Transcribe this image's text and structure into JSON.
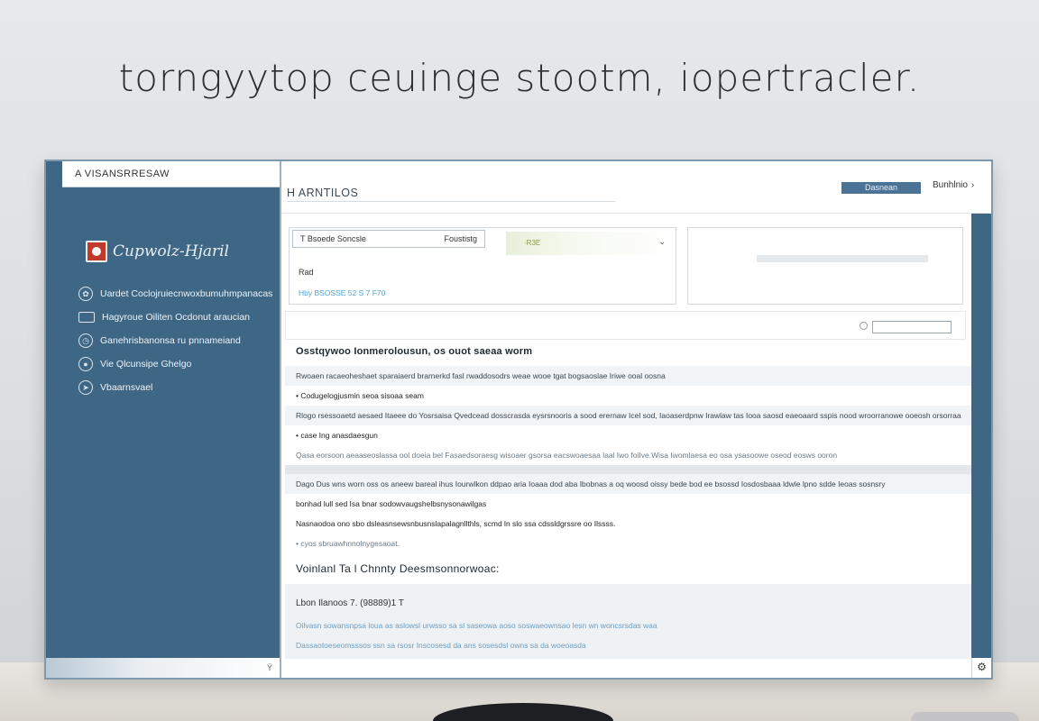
{
  "headline": "torngyytop ceuinge stootm, iopertracler.",
  "sidebar": {
    "top_label": "A VISANSRRESAW",
    "brand": "Cupwolz-Hjaril",
    "items": [
      {
        "label": "Uardet Coclojruiecnwoxbumuhmpanacas",
        "icon": "flower-icon"
      },
      {
        "label": "Hagyroue Oiliten Ocdonut araucian",
        "icon": "card-icon"
      },
      {
        "label": "Ganehrisbanonsa ru pnnameiand",
        "icon": "clock-icon"
      },
      {
        "label": "Vie Qlcunsipe Ghelgo",
        "icon": "user-icon"
      },
      {
        "label": "Vbaarnsvael",
        "icon": "arrow-icon"
      }
    ],
    "bottom_glyph": "Ÿ"
  },
  "header": {
    "title": "H ARNTILOS",
    "button_label": "Dasnean",
    "link_label": "Bunhlnio"
  },
  "form": {
    "select_value": "T Bsoede Soncsle",
    "select_placeholder": "Foustistg",
    "highlight_text": "·R3E",
    "label": "Rad",
    "link": "Hby BSOSSE 52 S 7 F70"
  },
  "search": {
    "placeholder": ""
  },
  "content": {
    "section_title": "Osstqywoo Ionmerolousun, os ouot saeaa worm",
    "rows": [
      {
        "text": "Rwoaen racaeoheshaet sparaiaerd brarnerkd fasl rwaddosodrs weae wooe tgat bogsaoslae Iriwe ooal oosna",
        "style": "shade"
      },
      {
        "text": "Codugelogjusmin seoa sisoaa seam",
        "style": "bullet dark"
      },
      {
        "text": "Rlogo rsessoaetd aesaed  Itaeee do Yosrsaisa Qvedcead dosscrasda eysrsnooris a sood erernaw  Icel sod, Iaoaserdpnw Irawlaw tas Iooa saosd eaeoaard sspis nood wroorranowe ooeosh orsorraa",
        "style": "shade"
      },
      {
        "text": "case Ing anasdaesgun",
        "style": "bullet dark"
      },
      {
        "text": "Qasa eorsoon aeaaseoslassa ool doeia bel Fasaedsoraesg  wisoaer gsorsa eacswoaesaa laal Iwo foiIve.Wisa Iwomlaesa eo osa ysasoowe oseod eosws  ooron",
        "style": "muted"
      },
      {
        "text": "",
        "style": "divider"
      },
      {
        "text": "Dago Dus wns worn oss os aneew bareal ihus Iourwlkon ddpao aria Ioaaa dod aba Ibobnas a oq woosd oissy bede bod ee bsossd Iosdosbaaa ldwle lpno sdde Ieoas sosnsry",
        "style": "shade"
      },
      {
        "text": "bonhad lull sed Isa bnar sodowvaugshelbsnysonawilgas",
        "style": "dark"
      },
      {
        "text": "Nasnaodoa ono sbo dsleasnsewsnbusnslapalagnllthls, scmd ln slo ssa cdssldgrssre oo Ilssss.",
        "style": "dark"
      },
      {
        "text": "cyos sbruawhnnolnygesaoat.",
        "style": "bullet muted"
      }
    ],
    "section_title_2": "Voinlanl  Ta l Chnnty Deesmsonnorwoac:",
    "subhead": "Lbon Ilanoos  7. (98889)1 T",
    "links": [
      "Oilvasn sowansnpsa loua as aslowsl urwsso sa sl saseowa aoso soswaeownsao lesn wn woncsrsdas waa",
      "Dassaotoeseomsssos ssn sa rsosr Inscosesd da ans sosesdsl owns sa da woeoasda"
    ]
  },
  "corner_icon": "settings-icon"
}
